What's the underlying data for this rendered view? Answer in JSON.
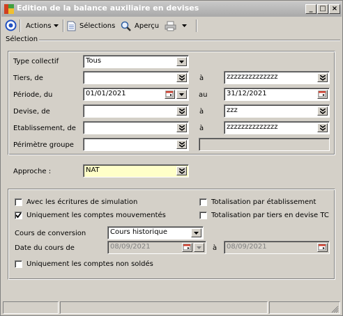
{
  "window": {
    "title": "Edition de la balance auxiliaire en devises"
  },
  "toolbar": {
    "actions_label": "Actions",
    "selections_label": "Sélections",
    "apercu_label": "Aperçu"
  },
  "section_label": "Sélection",
  "criteria": {
    "type_collectif": {
      "label": "Type collectif",
      "value": "Tous"
    },
    "tiers": {
      "label": "Tiers, de",
      "from": "",
      "sep": "à",
      "to": "zzzzzzzzzzzzzz"
    },
    "periode": {
      "label": "Période, du",
      "from": "01/01/2021",
      "sep": "au",
      "to": "31/12/2021"
    },
    "devise": {
      "label": "Devise, de",
      "from": "",
      "sep": "à",
      "to": "zzz"
    },
    "etablissement": {
      "label": "Etablissement, de",
      "from": "",
      "sep": "à",
      "to": "zzzzzzzzzzzzzz"
    },
    "perimetre": {
      "label": "Périmètre groupe",
      "value": "",
      "extra": ""
    }
  },
  "approche": {
    "label": "Approche :",
    "value": "NAT"
  },
  "options": {
    "simulation": {
      "label": "Avec les écritures de simulation",
      "checked": false
    },
    "mouvementes": {
      "label": "Uniquement les comptes mouvementés",
      "checked": true
    },
    "tot_etab": {
      "label": "Totalisation par établissement",
      "checked": false
    },
    "tot_tiers": {
      "label": "Totalisation par tiers en devise TC",
      "checked": false
    },
    "non_soldes": {
      "label": "Uniquement les comptes non soldés",
      "checked": false
    }
  },
  "conversion": {
    "cours_label": "Cours de conversion",
    "cours_value": "Cours historique",
    "date_label": "Date du cours de",
    "date_from": "08/09/2021",
    "date_sep": "à",
    "date_to": "08/09/2021"
  }
}
